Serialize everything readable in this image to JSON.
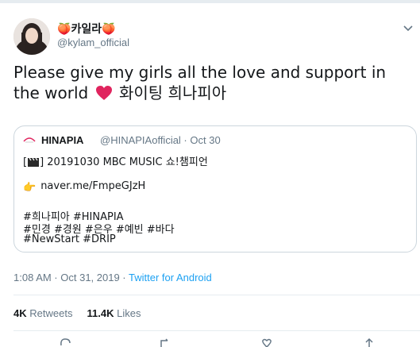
{
  "tweet": {
    "display_name": "카일라",
    "name_emoji": "🍑",
    "handle": "@kylam_official",
    "text_part1": "Please give my girls all the love and support in the world",
    "text_part2": "화이팅 희나피아",
    "timestamp": "1:08 AM · Oct 31, 2019 · ",
    "source": "Twitter for Android",
    "retweets_count": "4K",
    "retweets_label": "Retweets",
    "likes_count": "11.4K",
    "likes_label": "Likes"
  },
  "quote": {
    "name": "HINAPIA",
    "handle_date": "@HINAPIAofficial · Oct 30",
    "line1_prefix": "[",
    "line1_suffix": "] 20191030 MBC MUSIC 쇼!챔피언",
    "link": "naver.me/FmpeGJzH",
    "hashtags1": "#희나피아 #HINAPIA",
    "hashtags2": "#민경 #경원 #은우 #예빈 #바다",
    "hashtags3": "#NewStart #DRIP"
  },
  "colors": {
    "accent": "#1da1f2",
    "secondary_text": "#657786",
    "border": "#ccd6dd",
    "heart": "#e0245e"
  },
  "icons": [
    "chevron-down-icon",
    "heart-emoji-icon",
    "clapper-board-icon",
    "pointing-hand-icon",
    "reply-icon",
    "retweet-icon",
    "like-icon",
    "share-icon"
  ]
}
